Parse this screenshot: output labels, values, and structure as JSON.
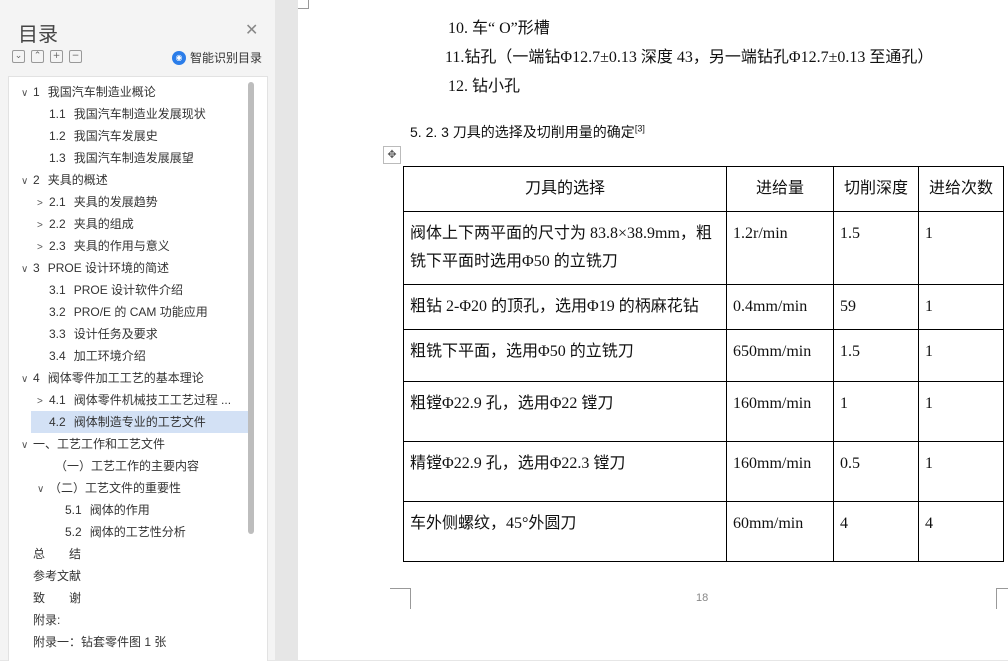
{
  "outline": {
    "title": "目录",
    "close_icon": "close-icon",
    "tools": [
      "collapse-all-icon",
      "expand-all-icon",
      "add-heading-icon",
      "remove-heading-icon"
    ],
    "smart_label": "智能识别目录",
    "items": [
      {
        "chev": "∨",
        "num": "1",
        "label": "我国汽车制造业概论"
      },
      {
        "chev": "",
        "num": "1.1",
        "label": "我国汽车制造业发展现状"
      },
      {
        "chev": "",
        "num": "1.2",
        "label": "我国汽车发展史"
      },
      {
        "chev": "",
        "num": "1.3",
        "label": "我国汽车制造发展展望"
      },
      {
        "chev": "∨",
        "num": "2",
        "label": "夹具的概述"
      },
      {
        "chev": ">",
        "num": "2.1",
        "label": "夹具的发展趋势"
      },
      {
        "chev": ">",
        "num": "2.2",
        "label": "夹具的组成"
      },
      {
        "chev": ">",
        "num": "2.3",
        "label": "夹具的作用与意义"
      },
      {
        "chev": "∨",
        "num": "3",
        "label": "PROE 设计环境的简述"
      },
      {
        "chev": "",
        "num": "3.1",
        "label": "PROE 设计软件介绍"
      },
      {
        "chev": "",
        "num": "3.2",
        "label": "PRO/E 的 CAM 功能应用"
      },
      {
        "chev": "",
        "num": "3.3",
        "label": "设计任务及要求"
      },
      {
        "chev": "",
        "num": "3.4",
        "label": "加工环境介绍"
      },
      {
        "chev": "∨",
        "num": "4",
        "label": "阀体零件加工工艺的基本理论"
      },
      {
        "chev": ">",
        "num": "4.1",
        "label": "阀体零件机械技工工艺过程 ..."
      },
      {
        "chev": "",
        "num": "4.2",
        "label": "阀体制造专业的工艺文件"
      },
      {
        "chev": "∨",
        "num": "",
        "label": "一、工艺工作和工艺文件"
      },
      {
        "chev": "",
        "num": "",
        "label": "（一）工艺工作的主要内容"
      },
      {
        "chev": "∨",
        "num": "",
        "label": "（二）工艺文件的重要性"
      },
      {
        "chev": "",
        "num": "5.1",
        "label": "阀体的作用"
      },
      {
        "chev": "",
        "num": "5.2",
        "label": "阀体的工艺性分析"
      },
      {
        "chev": "",
        "num": "",
        "label": "总　　结"
      },
      {
        "chev": "",
        "num": "",
        "label": "参考文献"
      },
      {
        "chev": "",
        "num": "",
        "label": "致　　谢"
      },
      {
        "chev": "",
        "num": "",
        "label": "附录:"
      },
      {
        "chev": "",
        "num": "",
        "label": "附录一：钻套零件图 1 张"
      }
    ]
  },
  "document": {
    "lines": [
      "10. 车“ O”形槽",
      "11.钻孔（一端钻Φ12.7±0.13 深度 43，另一端钻孔Φ12.7±0.13 至通孔）",
      "12. 钻小孔"
    ],
    "heading": "5. 2. 3 刀具的选择及切削用量的确定",
    "heading_ref": "[3]",
    "table": {
      "headers": [
        "刀具的选择",
        "进给量",
        "切削深度",
        "进给次数"
      ],
      "rows": [
        {
          "tool": "阀体上下两平面的尺寸为 83.8×38.9mm，粗铣下平面时选用Φ50 的立铣刀",
          "feed": "1.2r/min",
          "depth": "1.5",
          "passes": "1"
        },
        {
          "tool": "粗钻 2-Φ20 的顶孔，选用Φ19 的柄麻花钻",
          "feed": "0.4mm/min",
          "depth": "59",
          "passes": "1"
        },
        {
          "tool": "粗铣下平面，选用Φ50 的立铣刀",
          "feed": "650mm/min",
          "depth": "1.5",
          "passes": "1"
        },
        {
          "tool": "粗镗Φ22.9 孔，选用Φ22 镗刀",
          "feed": "160mm/min",
          "depth": "1",
          "passes": "1"
        },
        {
          "tool": "精镗Φ22.9 孔，选用Φ22.3 镗刀",
          "feed": "160mm/min",
          "depth": "0.5",
          "passes": "1"
        },
        {
          "tool": "车外侧螺纹，45°外圆刀",
          "feed": "60mm/min",
          "depth": "4",
          "passes": "4"
        }
      ]
    },
    "page_number": "18"
  },
  "colors": {
    "selected_item_bg": "#d3e1f5",
    "accent": "#2b7de9"
  }
}
